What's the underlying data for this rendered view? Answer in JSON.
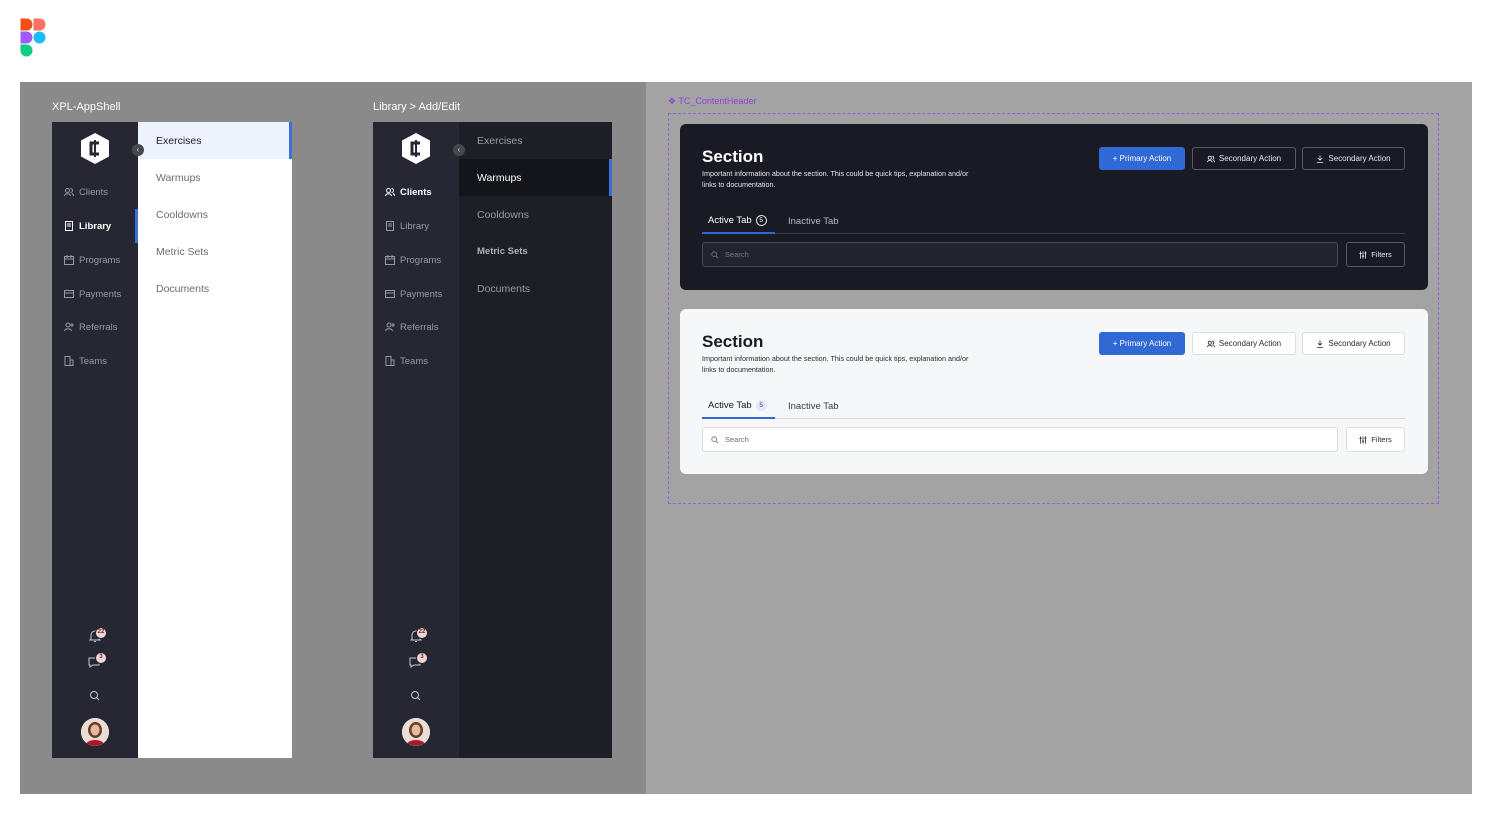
{
  "frames": {
    "shell_title": "XPL-AppShell",
    "edit_title": "Library > Add/Edit",
    "component_title": "TC_ContentHeader"
  },
  "nav": {
    "items": [
      {
        "label": "Clients",
        "icon": "users-icon"
      },
      {
        "label": "Library",
        "icon": "book-icon"
      },
      {
        "label": "Programs",
        "icon": "calendar-icon"
      },
      {
        "label": "Payments",
        "icon": "credit-card-icon"
      },
      {
        "label": "Referrals",
        "icon": "user-plus-icon"
      },
      {
        "label": "Teams",
        "icon": "building-icon"
      }
    ],
    "notifications_count": "22",
    "messages_count": "3"
  },
  "submenu": {
    "items": [
      "Exercises",
      "Warmups",
      "Cooldowns",
      "Metric Sets",
      "Documents"
    ]
  },
  "content_header": {
    "title": "Section",
    "description": "Important information about the section. This could be quick tips, explanation and/or links to documentation.",
    "primary_action": "+ Primary Action",
    "secondary_action_1": "Secondary Action",
    "secondary_action_2": "Secondary Action",
    "active_tab": "Active Tab",
    "active_tab_count": "5",
    "inactive_tab": "Inactive Tab",
    "search_placeholder": "Search",
    "filters_label": "Filters"
  },
  "colors": {
    "accent": "#3068d6",
    "rail_bg": "#272733",
    "component_outline": "#9b5ce0"
  }
}
